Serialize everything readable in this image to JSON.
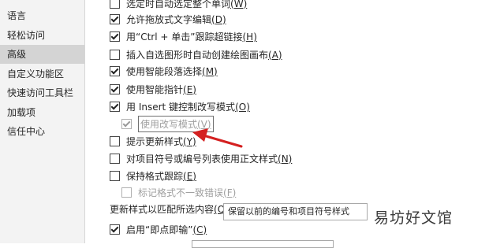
{
  "sidebar": {
    "items": [
      {
        "label": "语言"
      },
      {
        "label": "轻松访问"
      },
      {
        "label": "高级"
      },
      {
        "label": "自定义功能区"
      },
      {
        "label": "快速访问工具栏"
      },
      {
        "label": "加载项"
      },
      {
        "label": "信任中心"
      }
    ]
  },
  "options": {
    "auto_select_word": {
      "label": "选定时自动选定整个单词",
      "key": "(W)",
      "checked": false
    },
    "allow_drag_drop": {
      "label": "允许拖放式文字编辑",
      "key": "(D)",
      "checked": true
    },
    "ctrl_click_link": {
      "label": "用“Ctrl + 单击”跟踪超链接",
      "key": "(H)",
      "checked": true
    },
    "auto_canvas": {
      "label": "插入自选图形时自动创建绘图画布",
      "key": "(A)",
      "checked": false
    },
    "smart_paragraph": {
      "label": "使用智能段落选择",
      "key": "(M)",
      "checked": true
    },
    "smart_cursor": {
      "label": "使用智能指针",
      "key": "(E)",
      "checked": true
    },
    "insert_key_overtype": {
      "label": "用 Insert 键控制改写模式",
      "key": "(O)",
      "checked": true
    },
    "overtype_mode": {
      "label": "使用改写模式",
      "key": "(V)",
      "checked": true,
      "disabled": true
    },
    "prompt_style_update": {
      "label": "提示更新样式",
      "key": "(Y)",
      "checked": false
    },
    "normal_style_lists": {
      "label": "对项目符号或编号列表使用正文样式",
      "key": "(N)",
      "checked": false
    },
    "track_formatting": {
      "label": "保持格式跟踪",
      "key": "(E)",
      "checked": false
    },
    "mark_inconsistency": {
      "label": "标记格式不一致错误",
      "key": "(F)",
      "checked": false,
      "disabled": true
    },
    "click_and_type": {
      "label": "启用“即点即输”",
      "key": "(C)",
      "checked": true
    }
  },
  "style_update": {
    "label": "更新样式以匹配所选内容",
    "key": "(Q)",
    "selected": "保留以前的编号和项目符号样式"
  },
  "watermark": "易坊好文馆",
  "colors": {
    "arrow": "#d42020",
    "active_nav": "#d4d4d4"
  }
}
